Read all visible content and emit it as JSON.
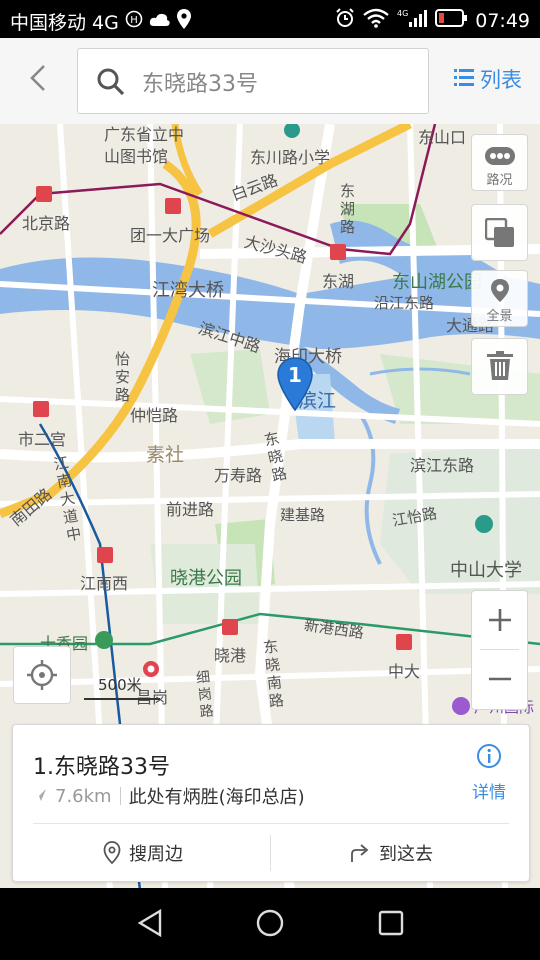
{
  "status_bar": {
    "carrier": "中国移动 4G",
    "time": "07:49"
  },
  "header": {
    "search_value": "东晓路33号",
    "list_label": "列表"
  },
  "map": {
    "labels": {
      "lib": "广东省立中\n山图书馆",
      "dongchuan": "东川路小学",
      "dongshankou": "东山口",
      "baiyun": "白云路",
      "donghulu": "东\n湖\n路",
      "beijing": "北京路",
      "tuanyi": "团一大广场",
      "dashatou": "大沙头路",
      "donghu": "东湖",
      "dongshanhu": "东山湖公园",
      "jiangwan": "江湾大桥",
      "yanjiang": "沿江东路",
      "datong": "大通路",
      "binjiangzhong": "滨江中路",
      "haiyin": "海印大桥",
      "binjiang": "滨江",
      "yian": "怡\n安\n路",
      "shierguan": "市二宫",
      "zhongkai": "仲恺路",
      "sushe": "素社",
      "wanshou": "万寿路",
      "dongxiaolu_v": "东\n晓\n路",
      "binjiangdong": "滨江东路",
      "jiangnandadao": "江\n南\n大\n道\n中",
      "nantian": "南田路",
      "qianjin": "前进路",
      "jianji": "建基路",
      "jiangyi": "江怡路",
      "zhongshan": "中山大学",
      "jiangnanxi": "江南西",
      "xiaogang": "晓港公园",
      "xingangxi": "新港西路",
      "shixiangyuan": "十香园",
      "xiaogang_st": "晓港",
      "dongxiaonan": "东\n晓\n南\n路",
      "zhongda": "中大",
      "changgang": "昌岗",
      "xigang": "细\n岗\n路",
      "guangzhou_intl": "广州国际"
    },
    "marker_number": "1",
    "controls": {
      "traffic_label": "路况",
      "panorama_label": "全景"
    },
    "scale_label": "500米"
  },
  "result_card": {
    "title": "1.东晓路33号",
    "distance": "7.6km",
    "description": "此处有炳胜(海印总店)",
    "detail_label": "详情",
    "nearby_label": "搜周边",
    "goto_label": "到这去"
  },
  "colors": {
    "accent": "#3a8de0",
    "water": "#8fb8e8",
    "park": "#c7e3b8",
    "metro_marker": "#e0454e",
    "major_road": "#f7c343"
  }
}
